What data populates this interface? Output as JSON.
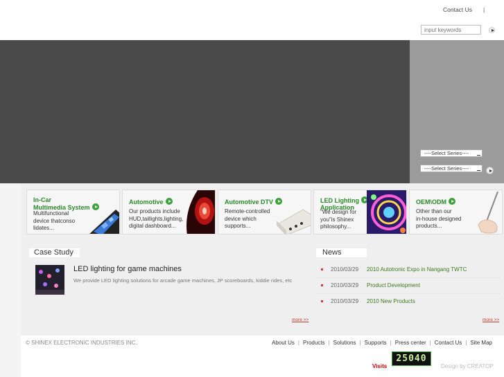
{
  "header": {
    "contact_label": "Contact Us",
    "separator": "|",
    "search_placeholder": "input keywords"
  },
  "hero": {
    "series_select_1": "----Select Series----",
    "series_select_2": "----Select Series----"
  },
  "products": [
    {
      "title_line1": "In-Car",
      "title_line2": "Multimedia System",
      "desc": [
        "Multifunctional",
        "device thatconso",
        "lidates..."
      ]
    },
    {
      "title_line1": "Automotive",
      "title_line2": "",
      "desc": [
        "Our products include",
        "HUD,taillights,lighting,",
        "digital dashboard..."
      ]
    },
    {
      "title_line1": "Automotive DTV",
      "title_line2": "",
      "desc": [
        "Remote-controlled",
        "device which",
        "supports..."
      ]
    },
    {
      "title_line1": "LED Lighting",
      "title_line2": "Application",
      "desc": [
        "\"We design for",
        "you\"is Shinex",
        "philosophy..."
      ]
    },
    {
      "title_line1": "OEM\\ODM",
      "title_line2": "",
      "desc": [
        "Other than our",
        "in-house designed",
        "products..."
      ]
    }
  ],
  "case_study": {
    "heading": "Case Study",
    "title": "LED lighting for game machines",
    "description": "We provide LED lighting solutions for arcade game machines, JP scoreboards, kiddie rides, etc",
    "more": "more >>"
  },
  "news": {
    "heading": "News",
    "items": [
      {
        "date": "2010/03/29",
        "title": "2010 Autotronic Expo in Nangang TWTC"
      },
      {
        "date": "2010/03/29",
        "title": "Product Development"
      },
      {
        "date": "2010/03/29",
        "title": "2010 New Products"
      }
    ],
    "more": "more >>"
  },
  "footer": {
    "copyright": "© SHINEX ELECTRONIC INDUSTRIES INC.",
    "links": [
      "About Us",
      "Products",
      "Solutions",
      "Supports",
      "Press center",
      "Contact Us",
      "Site Map"
    ],
    "visits_label": "Visits",
    "visits_count": "25040",
    "design_by": "Design by CREATOP"
  },
  "colors": {
    "hero_dark": "#4a4a4a",
    "hero_side": "#9b9b9b",
    "accent_green": "#2a8a2a",
    "news_green": "#3a7a1e",
    "more_red": "#c0392b"
  }
}
